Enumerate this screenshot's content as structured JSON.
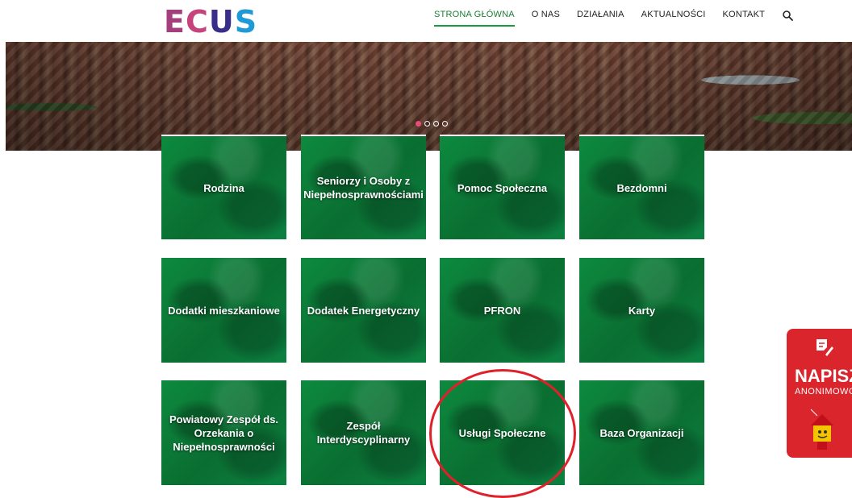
{
  "header": {
    "logo": {
      "letters": [
        "E",
        "C",
        "U",
        "S"
      ],
      "colors": [
        "#a43f7e",
        "#c6437b",
        "#3a2f88",
        "#1e9bd7"
      ]
    },
    "nav": [
      {
        "label": "STRONA GŁÓWNA",
        "active": true
      },
      {
        "label": "O NAS",
        "active": false
      },
      {
        "label": "DZIAŁANIA",
        "active": false
      },
      {
        "label": "AKTUALNOŚCI",
        "active": false
      },
      {
        "label": "KONTAKT",
        "active": false
      }
    ],
    "search_icon": "search-icon"
  },
  "hero": {
    "slides_count": 4,
    "active_slide": 1,
    "accent": "#e84c7a"
  },
  "tiles": [
    {
      "label": "Rodzina"
    },
    {
      "label": "Seniorzy i Osoby z Niepełnosprawnościami"
    },
    {
      "label": "Pomoc Społeczna"
    },
    {
      "label": "Bezdomni"
    },
    {
      "label": "Dodatki mieszkaniowe"
    },
    {
      "label": "Dodatek Energetyczny"
    },
    {
      "label": "PFRON"
    },
    {
      "label": "Karty"
    },
    {
      "label": "Powiatowy Zespół ds. Orzekania o Niepełnosprawności"
    },
    {
      "label": "Zespół Interdyscyplinarny"
    },
    {
      "label": "Usługi Społeczne"
    },
    {
      "label": "Baza Organizacji"
    }
  ],
  "highlight": {
    "tile": "Usługi Społeczne",
    "color": "#e0202a"
  },
  "side_badge": {
    "title": "NAPISZ",
    "subtitle": "ANONIMOWO",
    "color": "#d9252b",
    "icon": "pencil-note-icon"
  },
  "brand_color": "#0a6e31"
}
